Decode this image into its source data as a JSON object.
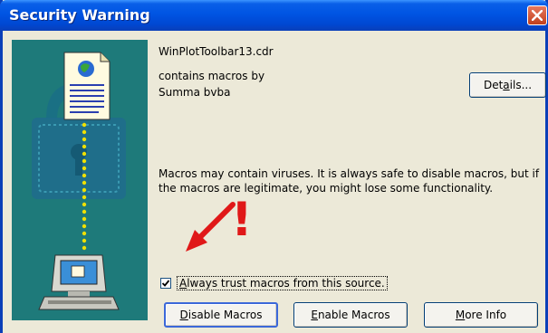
{
  "window": {
    "title": "Security Warning"
  },
  "file": {
    "name": "WinPlotToolbar13.cdr",
    "contains_label": "contains macros by",
    "publisher": "Summa bvba"
  },
  "buttons": {
    "details_pre": "Det",
    "details_acc": "a",
    "details_post": "ils...",
    "disable_acc": "D",
    "disable_rest": "isable Macros",
    "enable_acc": "E",
    "enable_rest": "nable Macros",
    "more_acc": "M",
    "more_rest": "ore Info"
  },
  "warning": {
    "text": "Macros may contain viruses. It is always safe to disable macros, but if the macros are legitimate, you might lose some functionality."
  },
  "trust": {
    "checked": true,
    "label_acc": "A",
    "label_rest": "lways trust macros from this source."
  },
  "annotation": {
    "exclamation": "!"
  },
  "colors": {
    "title_bar": "#0054e3",
    "dialog_bg": "#ece9d8",
    "left_panel": "#1e7a7a",
    "annotation_red": "#e01818"
  },
  "icons": [
    "close-icon",
    "document-icon",
    "padlock-icon",
    "computer-icon",
    "checkmark-icon",
    "arrow-annotation-icon"
  ]
}
